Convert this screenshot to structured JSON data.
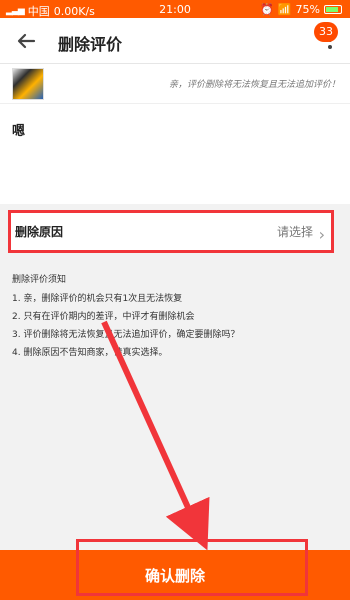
{
  "status_bar": {
    "carrier": "中国",
    "network_speed": "0.00K/s",
    "time": "21:00",
    "battery_pct": "75%"
  },
  "header": {
    "title": "删除评价",
    "badge_count": "33"
  },
  "product": {
    "warning_text": "亲，评价删除将无法恢复且无法追加评价！"
  },
  "comment": {
    "text": "嗯"
  },
  "reason": {
    "label": "删除原因",
    "placeholder": "请选择"
  },
  "notice": {
    "title": "删除评价须知",
    "items": [
      "1. 亲，删除评价的机会只有1次且无法恢复",
      "2. 只有在评价期内的差评，中评才有删除机会",
      "3. 评价删除将无法恢复且无法追加评价，确定要删除吗？",
      "4. 删除原因不告知商家，请真实选择。"
    ]
  },
  "footer": {
    "confirm_label": "确认删除"
  },
  "colors": {
    "accent_orange": "#ff5a00",
    "highlight_red": "#f1353a"
  }
}
